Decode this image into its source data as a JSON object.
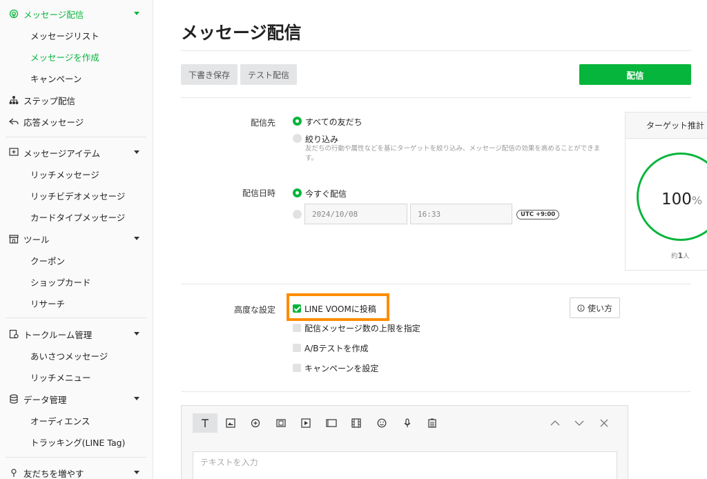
{
  "sidebar": {
    "groups": [
      {
        "label": "メッセージ配信",
        "icon": "broadcast-icon",
        "expanded": true,
        "active": true,
        "items": [
          "メッセージリスト",
          "メッセージを作成",
          "キャンペーン"
        ],
        "active_item": "メッセージを作成"
      },
      {
        "label": "ステップ配信",
        "icon": "tree-icon"
      },
      {
        "label": "応答メッセージ",
        "icon": "reply-icon"
      },
      {
        "label": "メッセージアイテム",
        "icon": "add-message-icon",
        "expanded": true,
        "items": [
          "リッチメッセージ",
          "リッチビデオメッセージ",
          "カードタイプメッセージ"
        ]
      },
      {
        "label": "ツール",
        "icon": "store-icon",
        "expanded": true,
        "items": [
          "クーポン",
          "ショップカード",
          "リサーチ"
        ]
      },
      {
        "label": "トークルーム管理",
        "icon": "chat-settings-icon",
        "expanded": true,
        "items": [
          "あいさつメッセージ",
          "リッチメニュー"
        ]
      },
      {
        "label": "データ管理",
        "icon": "database-icon",
        "expanded": true,
        "items": [
          "オーディエンス",
          "トラッキング(LINE Tag)"
        ]
      },
      {
        "label": "友だちを増やす",
        "icon": "location-icon"
      }
    ]
  },
  "page": {
    "title": "メッセージ配信",
    "buttons": {
      "draft": "下書き保存",
      "test": "テスト配信",
      "send": "配信"
    }
  },
  "recipients": {
    "label": "配信先",
    "options": [
      {
        "label": "すべての友だち",
        "selected": true
      },
      {
        "label": "絞り込み",
        "selected": false
      }
    ],
    "help": "友だちの行動や属性などを基にターゲットを絞り込み、メッセージ配信の効果を高めることができます。"
  },
  "schedule": {
    "label": "配信日時",
    "now_label": "今すぐ配信",
    "date": "2024/10/08",
    "time": "16:33",
    "timezone": "UTC +9:00"
  },
  "target": {
    "title": "ターゲット推計",
    "value": "100",
    "unit": "%",
    "approx_prefix": "約",
    "approx_value": "1",
    "approx_suffix": "人"
  },
  "advanced": {
    "label": "高度な設定",
    "options": [
      {
        "label": "LINE VOOMに投稿",
        "checked": true
      },
      {
        "label": "配信メッセージ数の上限を指定",
        "checked": false
      },
      {
        "label": "A/Bテストを作成",
        "checked": false
      },
      {
        "label": "キャンペーンを設定",
        "checked": false
      }
    ],
    "howto": "使い方"
  },
  "editor": {
    "placeholder": "テキストを入力",
    "tools": [
      "text-icon",
      "image-icon",
      "sticker-icon",
      "coupon-icon",
      "video-icon",
      "card-icon",
      "rich-video-icon",
      "emoji-icon",
      "voice-icon",
      "research-icon"
    ]
  },
  "colors": {
    "accent": "#06b53b",
    "highlight": "#ff8c00"
  }
}
